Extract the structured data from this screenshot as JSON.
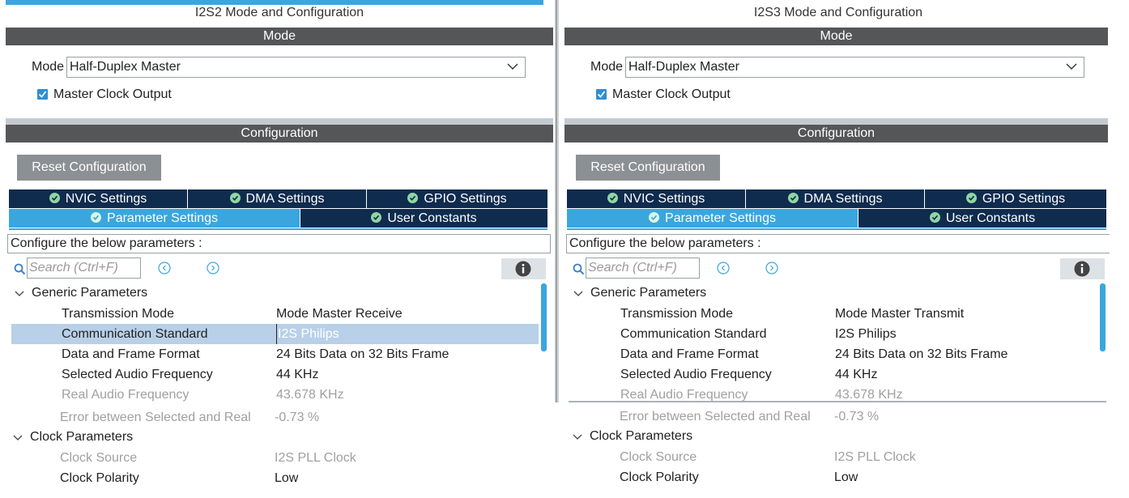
{
  "left": {
    "title": "I2S2 Mode and Configuration",
    "mode_header": "Mode",
    "mode_label": "Mode",
    "mode_value": "Half-Duplex Master",
    "master_clock_label": "Master Clock Output",
    "master_clock_checked": true,
    "config_header": "Configuration",
    "reset_button": "Reset Configuration",
    "tabs_row1": [
      "NVIC Settings",
      "DMA Settings",
      "GPIO Settings"
    ],
    "tabs_row2": [
      "Parameter Settings",
      "User Constants"
    ],
    "active_tab": "Parameter Settings",
    "configure_text": "Configure the below parameters :",
    "search_placeholder": "Search (Ctrl+F)",
    "generic_group": "Generic Parameters",
    "params": [
      {
        "name": "Transmission Mode",
        "value": "Mode Master Receive"
      },
      {
        "name": "Communication Standard",
        "value": "I2S Philips"
      },
      {
        "name": "Data and Frame Format",
        "value": "24 Bits Data on 32 Bits Frame"
      },
      {
        "name": "Selected Audio Frequency",
        "value": "44 KHz"
      },
      {
        "name": "Real Audio Frequency",
        "value": "43.678 KHz"
      },
      {
        "name": "Error between Selected and Real",
        "value": "-0.73 %"
      }
    ],
    "clock_group": "Clock Parameters",
    "clock_params": [
      {
        "name": "Clock Source",
        "value": "I2S PLL Clock"
      },
      {
        "name": "Clock Polarity",
        "value": "Low"
      }
    ]
  },
  "right": {
    "title": "I2S3 Mode and Configuration",
    "mode_header": "Mode",
    "mode_label": "Mode",
    "mode_value": "Half-Duplex Master",
    "master_clock_label": "Master Clock Output",
    "master_clock_checked": true,
    "config_header": "Configuration",
    "reset_button": "Reset Configuration",
    "tabs_row1": [
      "NVIC Settings",
      "DMA Settings",
      "GPIO Settings"
    ],
    "tabs_row2": [
      "Parameter Settings",
      "User Constants"
    ],
    "active_tab": "Parameter Settings",
    "configure_text": "Configure the below parameters :",
    "search_placeholder": "Search (Ctrl+F)",
    "generic_group": "Generic Parameters",
    "params": [
      {
        "name": "Transmission Mode",
        "value": "Mode Master Transmit"
      },
      {
        "name": "Communication Standard",
        "value": "I2S Philips"
      },
      {
        "name": "Data and Frame Format",
        "value": "24 Bits Data on 32 Bits Frame"
      },
      {
        "name": "Selected Audio Frequency",
        "value": "44 KHz"
      },
      {
        "name": "Real Audio Frequency",
        "value": "43.678 KHz"
      },
      {
        "name": "Error between Selected and Real",
        "value": "-0.73 %"
      }
    ],
    "clock_group": "Clock Parameters",
    "clock_params": [
      {
        "name": "Clock Source",
        "value": "I2S PLL Clock"
      },
      {
        "name": "Clock Polarity",
        "value": "Low"
      }
    ]
  },
  "colors": {
    "accent_blue": "#3ba6dd",
    "tab_navy": "#0f2b4e",
    "header_gray": "#545658",
    "selected_row": "#b8d0e8"
  }
}
